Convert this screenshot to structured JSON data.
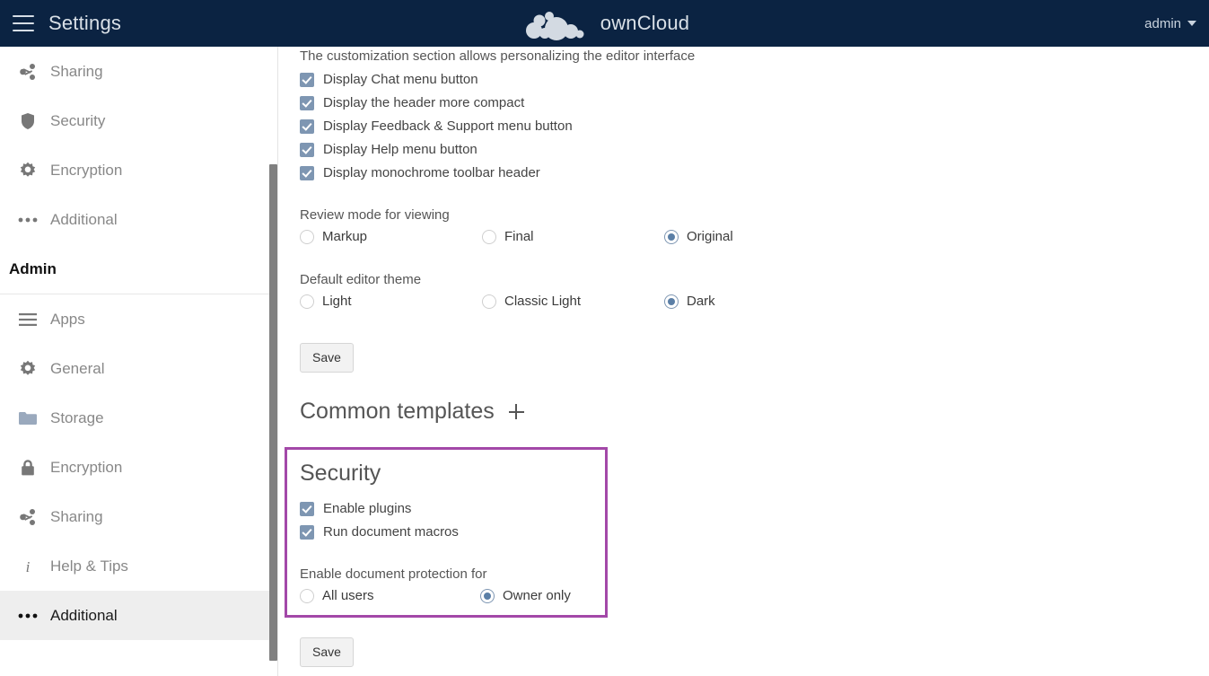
{
  "header": {
    "menu_icon": "hamburger-icon",
    "title": "Settings",
    "brand_name": "ownCloud",
    "brand_logo_icon": "owncloud-cloud-logo",
    "user": "admin",
    "user_caret_icon": "chevron-down-icon"
  },
  "sidebar": {
    "personal_items": [
      {
        "icon": "share-icon",
        "label": "Sharing"
      },
      {
        "icon": "shield-icon",
        "label": "Security"
      },
      {
        "icon": "gear-icon",
        "label": "Encryption"
      },
      {
        "icon": "ellipsis-icon",
        "label": "Additional"
      }
    ],
    "section_label": "Admin",
    "admin_items": [
      {
        "icon": "list-icon",
        "label": "Apps",
        "active": false
      },
      {
        "icon": "gear-icon",
        "label": "General",
        "active": false
      },
      {
        "icon": "folder-icon",
        "label": "Storage",
        "active": false
      },
      {
        "icon": "lock-icon",
        "label": "Encryption",
        "active": false
      },
      {
        "icon": "share-icon",
        "label": "Sharing",
        "active": false
      },
      {
        "icon": "info-icon",
        "label": "Help & Tips",
        "active": false
      },
      {
        "icon": "ellipsis-icon",
        "label": "Additional",
        "active": true
      }
    ],
    "scrollbar_icon": "vertical-scrollbar"
  },
  "main": {
    "customization_note": "The customization section allows personalizing the editor interface",
    "customization_checkboxes": [
      {
        "label": "Display Chat menu button",
        "checked": true
      },
      {
        "label": "Display the header more compact",
        "checked": true
      },
      {
        "label": "Display Feedback & Support menu button",
        "checked": true
      },
      {
        "label": "Display Help menu button",
        "checked": true
      },
      {
        "label": "Display monochrome toolbar header",
        "checked": true
      }
    ],
    "review_mode": {
      "label": "Review mode for viewing",
      "options": [
        {
          "label": "Markup",
          "selected": false
        },
        {
          "label": "Final",
          "selected": false
        },
        {
          "label": "Original",
          "selected": true
        }
      ]
    },
    "editor_theme": {
      "label": "Default editor theme",
      "options": [
        {
          "label": "Light",
          "selected": false
        },
        {
          "label": "Classic Light",
          "selected": false
        },
        {
          "label": "Dark",
          "selected": true
        }
      ]
    },
    "save_label_top": "Save",
    "common_templates": {
      "title": "Common templates",
      "add_icon": "plus-icon"
    },
    "security": {
      "title": "Security",
      "highlight_color": "#a348a8",
      "checkboxes": [
        {
          "label": "Enable plugins",
          "checked": true
        },
        {
          "label": "Run document macros",
          "checked": true
        }
      ],
      "protection": {
        "label": "Enable document protection for",
        "options": [
          {
            "label": "All users",
            "selected": false
          },
          {
            "label": "Owner only",
            "selected": true
          }
        ]
      }
    },
    "save_label_bottom": "Save"
  }
}
